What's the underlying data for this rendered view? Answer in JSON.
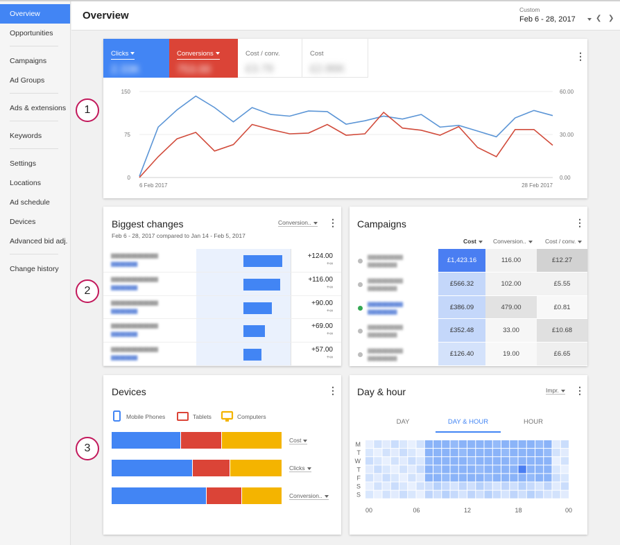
{
  "sidebar": {
    "items": [
      {
        "label": "Overview"
      },
      {
        "label": "Opportunities"
      },
      {
        "label": "Campaigns"
      },
      {
        "label": "Ad Groups"
      },
      {
        "label": "Ads & extensions"
      },
      {
        "label": "Keywords"
      },
      {
        "label": "Settings"
      },
      {
        "label": "Locations"
      },
      {
        "label": "Ad schedule"
      },
      {
        "label": "Devices"
      },
      {
        "label": "Advanced bid adj."
      },
      {
        "label": "Change history"
      }
    ]
  },
  "header": {
    "title": "Overview",
    "date_label": "Custom",
    "date_range": "Feb 6 - 28, 2017"
  },
  "colors": {
    "accent": "#4285f4",
    "clicks": "#5b95d6",
    "conversions": "#d14b3b",
    "tablets": "#db4437",
    "computers": "#f4b400",
    "callout": "#c2185b"
  },
  "icons": {
    "mobile": "mobile-phone-icon",
    "tablet": "tablet-icon",
    "computer": "computer-monitor-icon",
    "menu": "more-vert-icon",
    "dropdown": "arrow-drop-down-icon",
    "prev": "chevron-left-icon",
    "next": "chevron-right-icon"
  },
  "overview_card": {
    "metrics": [
      {
        "label": "Clicks",
        "value": "2.33K"
      },
      {
        "label": "Conversions",
        "value": "753.00"
      },
      {
        "label": "Cost / conv.",
        "value": "£3.79"
      },
      {
        "label": "Cost",
        "value": "£2.86K"
      }
    ],
    "start_date": "6 Feb 2017",
    "end_date": "28 Feb 2017"
  },
  "chart_data": {
    "type": "line",
    "x": [
      "6 Feb 2017",
      "",
      "",
      "",
      "",
      "",
      "",
      "",
      "",
      "",
      "",
      "",
      "",
      "",
      "",
      "",
      "",
      "",
      "",
      "",
      "",
      "",
      "28 Feb 2017"
    ],
    "series": [
      {
        "name": "Clicks",
        "axis": "left",
        "values": [
          2,
          88,
          118,
          142,
          122,
          97,
          122,
          110,
          107,
          116,
          115,
          93,
          99,
          107,
          102,
          110,
          88,
          91,
          81,
          71,
          104,
          117,
          108
        ]
      },
      {
        "name": "Conversions",
        "axis": "right",
        "values": [
          0,
          14.5,
          27,
          31.5,
          18.5,
          23,
          37,
          33.5,
          30.5,
          31,
          37,
          29.5,
          30.5,
          45.5,
          34.5,
          33,
          29.5,
          35.5,
          21,
          14.5,
          33.5,
          33.5,
          22.5
        ]
      }
    ],
    "y_left_ticks": [
      "0",
      "75",
      "150"
    ],
    "y_right_ticks": [
      "0.00",
      "30.00",
      "60.00"
    ],
    "ylim_left": [
      0,
      150
    ],
    "ylim_right": [
      0,
      60
    ],
    "grid": true
  },
  "biggest_changes": {
    "title": "Biggest changes",
    "subtitle": "Feb 6 - 28, 2017 compared to Jan 14 - Feb 5, 2017",
    "dropdown": "Conversion..",
    "rows": [
      {
        "value": "+124.00",
        "sub": "+∞",
        "bar": 1.0
      },
      {
        "value": "+116.00",
        "sub": "+∞",
        "bar": 0.94
      },
      {
        "value": "+90.00",
        "sub": "+∞",
        "bar": 0.73
      },
      {
        "value": "+69.00",
        "sub": "+∞",
        "bar": 0.56
      },
      {
        "value": "+57.00",
        "sub": "+∞",
        "bar": 0.46
      }
    ]
  },
  "campaigns": {
    "title": "Campaigns",
    "columns": [
      "Cost",
      "Conversion..",
      "Cost / conv."
    ],
    "rows": [
      {
        "cost": "£1,423.16",
        "conv": "116.00",
        "cpc": "£12.27"
      },
      {
        "cost": "£566.32",
        "conv": "102.00",
        "cpc": "£5.55"
      },
      {
        "cost": "£386.09",
        "conv": "479.00",
        "cpc": "£0.81"
      },
      {
        "cost": "£352.48",
        "conv": "33.00",
        "cpc": "£10.68"
      },
      {
        "cost": "£126.40",
        "conv": "19.00",
        "cpc": "£6.65"
      }
    ]
  },
  "devices": {
    "title": "Devices",
    "legend": [
      "Mobile Phones",
      "Tablets",
      "Computers"
    ],
    "rows": [
      {
        "label": "Cost",
        "shares": [
          0.405,
          0.24,
          0.355
        ]
      },
      {
        "label": "Clicks",
        "shares": [
          0.475,
          0.22,
          0.305
        ]
      },
      {
        "label": "Conversion..",
        "shares": [
          0.555,
          0.21,
          0.235
        ]
      }
    ]
  },
  "day_hour": {
    "title": "Day & hour",
    "dropdown": "Impr.",
    "tabs": [
      "DAY",
      "DAY & HOUR",
      "HOUR"
    ],
    "days": [
      "M",
      "T",
      "W",
      "T",
      "F",
      "S",
      "S"
    ],
    "hours": [
      "00",
      "06",
      "12",
      "18",
      "00"
    ]
  },
  "callouts": [
    "1",
    "2",
    "3"
  ]
}
